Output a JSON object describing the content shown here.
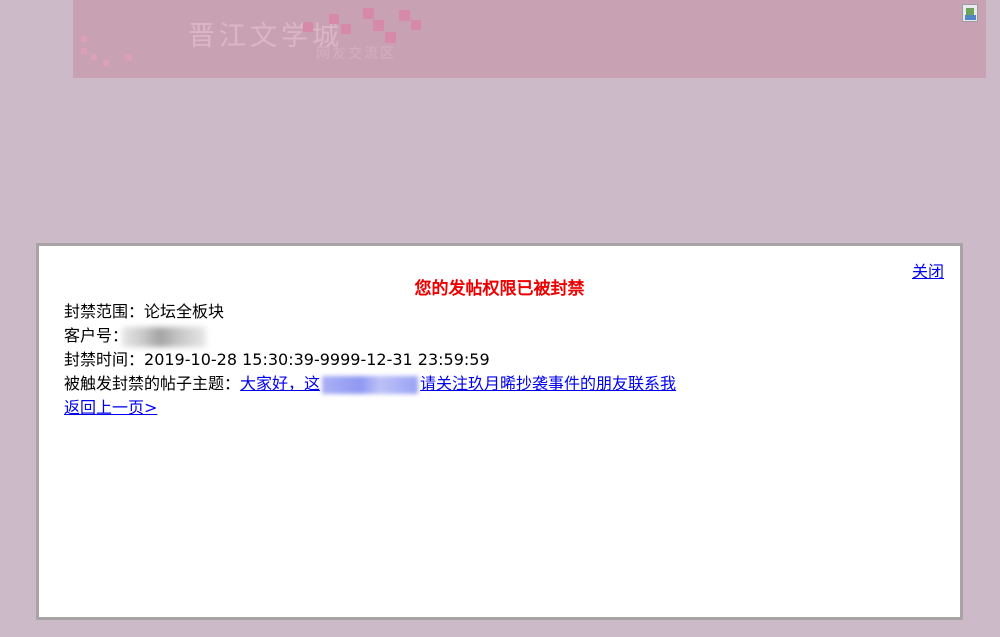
{
  "banner": {
    "title": "晋江文学城",
    "subtitle": "网友交流区"
  },
  "dialog": {
    "close_label": "关闭",
    "title": "您的发帖权限已被封禁",
    "ban_scope_label": "封禁范围：",
    "ban_scope_value": "论坛全板块",
    "client_id_label": "客户号：",
    "ban_time_label": "封禁时间：",
    "ban_time_value": "2019-10-28 15:30:39-9999-12-31 23:59:59",
    "trigger_post_label": "被触发封禁的帖子主题：",
    "trigger_post_title_start": "大家好，这",
    "trigger_post_title_end": "请关注玖月晞抄袭事件的朋友联系我",
    "back_link": "返回上一页>"
  },
  "colors": {
    "page_bg": "#cdbac9",
    "banner_bg": "#c8a2b3",
    "title_red": "#ee0000",
    "link_blue": "#0000ee"
  }
}
